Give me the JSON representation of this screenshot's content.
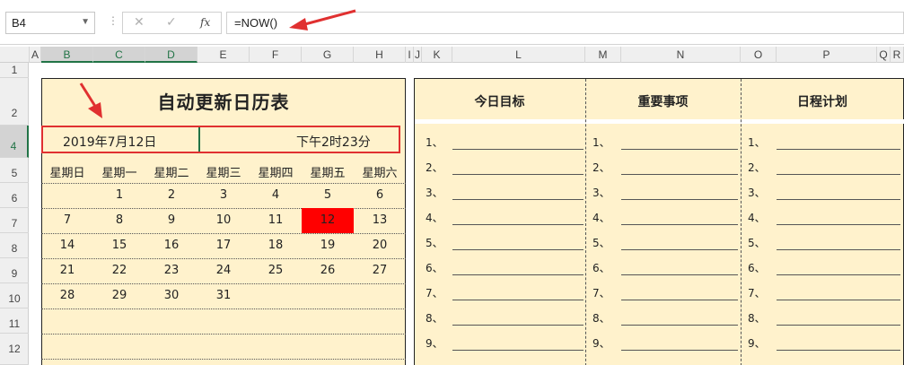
{
  "formula_bar": {
    "name_box": "B4",
    "formula": "=NOW()",
    "cancel_icon": "close-icon",
    "confirm_icon": "check-icon",
    "fx_label": "fx"
  },
  "columns": [
    "A",
    "B",
    "C",
    "D",
    "E",
    "F",
    "G",
    "H",
    "I",
    "J",
    "K",
    "L",
    "M",
    "N",
    "O",
    "P",
    "Q",
    "R"
  ],
  "rows": [
    "1",
    "2",
    "4",
    "5",
    "6",
    "7",
    "8",
    "9",
    "10",
    "11",
    "12"
  ],
  "selected_cell": "B4",
  "calendar": {
    "title": "自动更新日历表",
    "date": "2019年7月12日",
    "time": "下午2时23分",
    "weekdays": [
      "星期日",
      "星期一",
      "星期二",
      "星期三",
      "星期四",
      "星期五",
      "星期六"
    ],
    "weeks": [
      [
        "",
        "1",
        "2",
        "3",
        "4",
        "5",
        "6"
      ],
      [
        "7",
        "8",
        "9",
        "10",
        "11",
        "12",
        "13"
      ],
      [
        "14",
        "15",
        "16",
        "17",
        "18",
        "19",
        "20"
      ],
      [
        "21",
        "22",
        "23",
        "24",
        "25",
        "26",
        "27"
      ],
      [
        "28",
        "29",
        "30",
        "31",
        "",
        "",
        ""
      ]
    ],
    "highlight_day": "12",
    "highlight_color": "#ff0000"
  },
  "planner": {
    "columns": [
      {
        "title": "今日目标",
        "items": [
          "1、",
          "2、",
          "3、",
          "4、",
          "5、",
          "6、",
          "7、",
          "8、",
          "9、"
        ]
      },
      {
        "title": "重要事项",
        "items": [
          "1、",
          "2、",
          "3、",
          "4、",
          "5、",
          "6、",
          "7、",
          "8、",
          "9、"
        ]
      },
      {
        "title": "日程计划",
        "items": [
          "1、",
          "2、",
          "3、",
          "4、",
          "5、",
          "6、",
          "7、",
          "8、",
          "9、"
        ]
      }
    ]
  },
  "colors": {
    "panel_bg": "#fff2cc",
    "selection_border": "#e03030",
    "arrow": "#e03030",
    "excel_green": "#217346"
  }
}
